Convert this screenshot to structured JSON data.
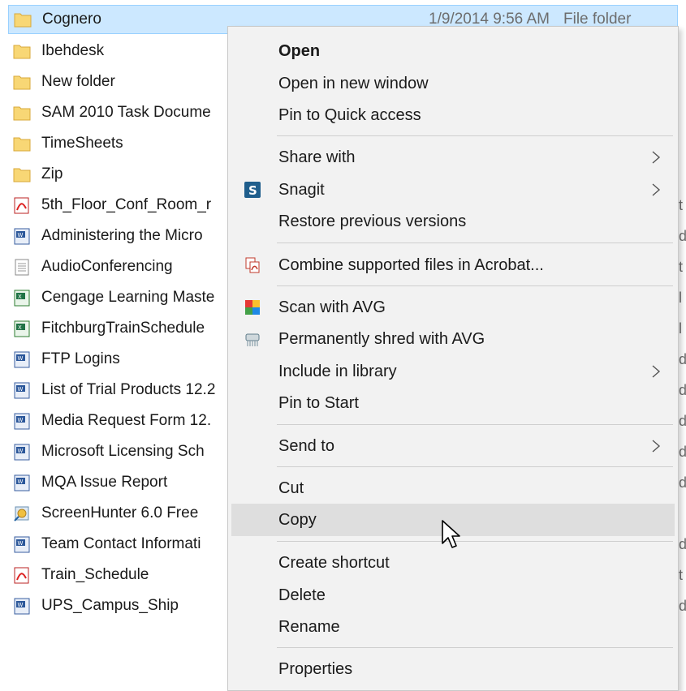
{
  "selected_file": {
    "name": "Cognero",
    "date_modified": "1/9/2014 9:56 AM",
    "type": "File folder",
    "icon": "folder-icon"
  },
  "files": [
    {
      "name": "Ibehdesk",
      "icon": "folder-icon",
      "tail": ""
    },
    {
      "name": "New folder",
      "icon": "folder-icon",
      "tail": ""
    },
    {
      "name": "SAM 2010 Task Docume",
      "icon": "folder-icon",
      "tail": ""
    },
    {
      "name": "TimeSheets",
      "icon": "folder-icon",
      "tail": ""
    },
    {
      "name": "Zip",
      "icon": "folder-icon",
      "tail": ""
    },
    {
      "name": "5th_Floor_Conf_Room_r",
      "icon": "pdf-icon",
      "tail": "t"
    },
    {
      "name": "Administering the Micro",
      "icon": "word-doc-icon",
      "tail": "d"
    },
    {
      "name": "AudioConferencing",
      "icon": "text-file-icon",
      "tail": "t"
    },
    {
      "name": "Cengage Learning Maste",
      "icon": "excel-icon",
      "tail": "l"
    },
    {
      "name": "FitchburgTrainSchedule",
      "icon": "excel-icon",
      "tail": "l"
    },
    {
      "name": "FTP Logins",
      "icon": "word-doc-icon",
      "tail": "d"
    },
    {
      "name": "List of Trial Products 12.2",
      "icon": "word-doc-icon",
      "tail": "d"
    },
    {
      "name": "Media Request Form 12.",
      "icon": "word-doc-icon",
      "tail": "d"
    },
    {
      "name": "Microsoft Licensing Sch",
      "icon": "word-doc-icon",
      "tail": "d"
    },
    {
      "name": "MQA Issue Report",
      "icon": "word-doc-icon",
      "tail": "d"
    },
    {
      "name": "ScreenHunter 6.0 Free",
      "icon": "app-shortcut-icon",
      "tail": ""
    },
    {
      "name": "Team Contact Informati",
      "icon": "word-doc-icon",
      "tail": "d"
    },
    {
      "name": "Train_Schedule",
      "icon": "pdf-icon",
      "tail": "t"
    },
    {
      "name": "UPS_Campus_Ship",
      "icon": "word-doc-icon",
      "tail": "d"
    }
  ],
  "context_menu": {
    "items": [
      {
        "label": "Open",
        "bold": true
      },
      {
        "label": "Open in new window"
      },
      {
        "label": "Pin to Quick access"
      },
      {
        "label": "Share with",
        "submenu": true
      },
      {
        "label": "Snagit",
        "icon": "snagit-icon",
        "submenu": true
      },
      {
        "label": "Restore previous versions"
      },
      {
        "label": "Combine supported files in Acrobat...",
        "icon": "acrobat-icon"
      },
      {
        "label": "Scan with AVG",
        "icon": "avg-icon"
      },
      {
        "label": "Permanently shred with AVG",
        "icon": "shredder-icon"
      },
      {
        "label": "Include in library",
        "submenu": true
      },
      {
        "label": "Pin to Start"
      },
      {
        "label": "Send to",
        "submenu": true
      },
      {
        "label": "Cut"
      },
      {
        "label": "Copy",
        "hover": true
      },
      {
        "label": "Create shortcut"
      },
      {
        "label": "Delete"
      },
      {
        "label": "Rename"
      },
      {
        "label": "Properties"
      }
    ]
  },
  "colors": {
    "selection_bg": "#cce8ff",
    "menu_bg": "#f2f2f2",
    "hover_bg": "#dedede"
  }
}
